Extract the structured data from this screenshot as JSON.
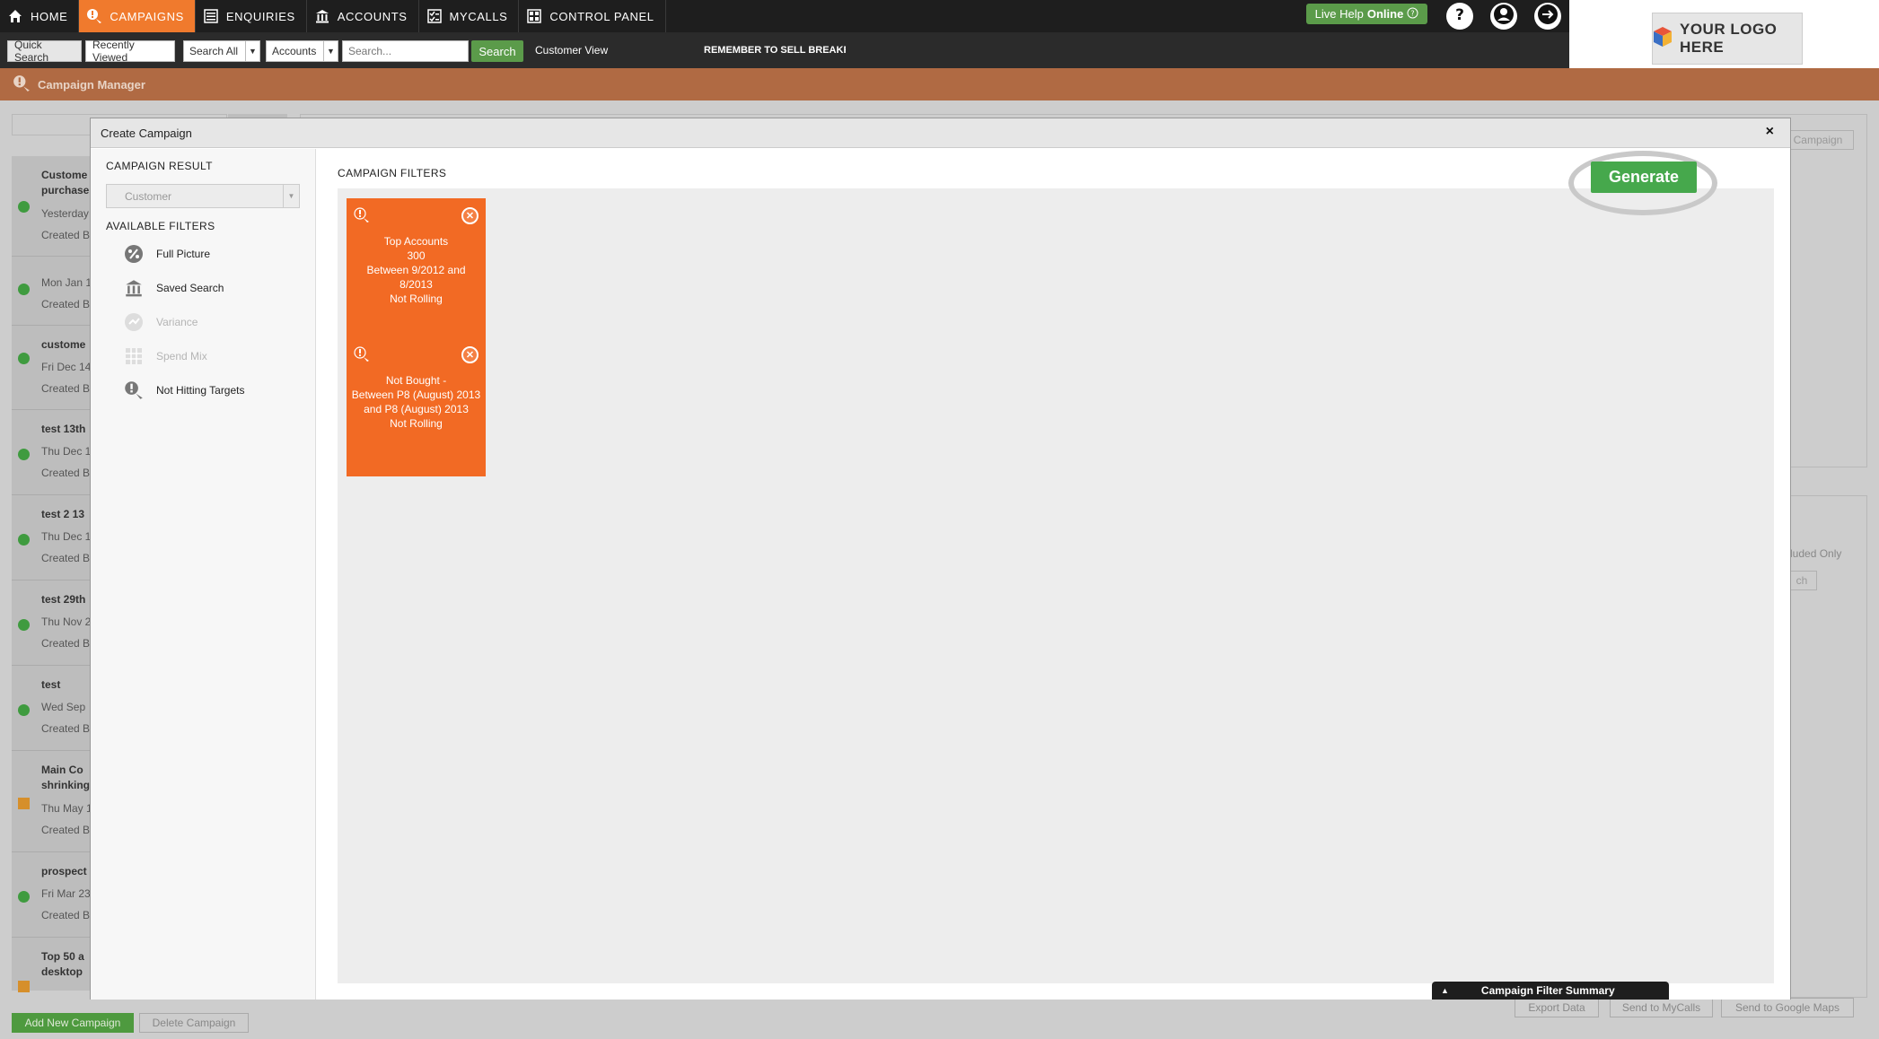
{
  "nav": {
    "items": [
      {
        "label": "HOME",
        "icon": "home-icon"
      },
      {
        "label": "CAMPAIGNS",
        "icon": "campaign-icon"
      },
      {
        "label": "ENQUIRIES",
        "icon": "enquiries-icon"
      },
      {
        "label": "ACCOUNTS",
        "icon": "bank-icon"
      },
      {
        "label": "MYCALLS",
        "icon": "checklist-icon"
      },
      {
        "label": "CONTROL PANEL",
        "icon": "grid-icon"
      }
    ],
    "live_help": "Live Help",
    "live_help_status": "Online"
  },
  "searchbar": {
    "quick_search": "Quick Search",
    "recently_viewed": "Recently Viewed",
    "search_all": "Search All",
    "accounts": "Accounts",
    "search_placeholder": "Search...",
    "search_button": "Search",
    "customer_view": "Customer View",
    "reminder": "REMEMBER TO SELL BREAKROOM"
  },
  "logo": {
    "text": "YOUR LOGO HERE"
  },
  "campaign_manager": {
    "title": "Campaign Manager"
  },
  "bg_list": [
    {
      "title": "Custome",
      "title2": "purchase",
      "date": "Yesterday",
      "created": "Created B",
      "status": "green"
    },
    {
      "title": "",
      "date": "Mon Jan 1",
      "created": "Created B",
      "status": "green"
    },
    {
      "title": "custome",
      "date": "Fri Dec 14",
      "created": "Created B",
      "status": "green"
    },
    {
      "title": "test 13th",
      "date": "Thu Dec 1",
      "created": "Created B",
      "status": "green"
    },
    {
      "title": "test 2 13",
      "date": "Thu Dec 1",
      "created": "Created B",
      "status": "green"
    },
    {
      "title": "test 29th",
      "date": "Thu Nov 2",
      "created": "Created B",
      "status": "green"
    },
    {
      "title": "test",
      "date": "Wed Sep",
      "created": "Created B",
      "status": "green"
    },
    {
      "title": "Main Co",
      "title2": "shrinking",
      "date": "Thu May 1",
      "created": "Created B",
      "status": "orange"
    },
    {
      "title": "prospect",
      "date": "Fri Mar 23",
      "created": "Created B",
      "status": "green"
    },
    {
      "title": "Top 50 a",
      "title2": "desktop",
      "date": "",
      "created": "",
      "status": "orange"
    }
  ],
  "bg_buttons": {
    "add": "Add New Campaign",
    "delete": "Delete Campaign",
    "export": "Export Data",
    "send_mycalls": "Send to MyCalls",
    "send_maps": "Send to Google Maps",
    "campaign": "Campaign",
    "excluded_only": "luded Only",
    "ch": "ch"
  },
  "modal": {
    "title": "Create Campaign",
    "close": "×",
    "campaign_result_label": "CAMPAIGN RESULT",
    "campaign_result_value": "Customer",
    "available_filters_label": "AVAILABLE FILTERS",
    "filters": [
      {
        "label": "Full Picture",
        "icon": "pie-chart-icon",
        "enabled": true
      },
      {
        "label": "Saved Search",
        "icon": "bank-icon",
        "enabled": true
      },
      {
        "label": "Variance",
        "icon": "variance-icon",
        "enabled": false
      },
      {
        "label": "Spend Mix",
        "icon": "table-icon",
        "enabled": false
      },
      {
        "label": "Not Hitting Targets",
        "icon": "target-person-icon",
        "enabled": true
      }
    ],
    "campaign_filters_label": "CAMPAIGN FILTERS",
    "tiles": [
      {
        "lines": [
          "Top Accounts",
          "300",
          "Between 9/2012 and",
          "8/2013",
          "Not Rolling"
        ]
      },
      {
        "lines": [
          "Not Bought -",
          "Between P8 (August) 2013",
          "and P8 (August) 2013",
          "Not Rolling"
        ]
      }
    ],
    "generate": "Generate",
    "summary_tab": "Campaign Filter Summary"
  }
}
